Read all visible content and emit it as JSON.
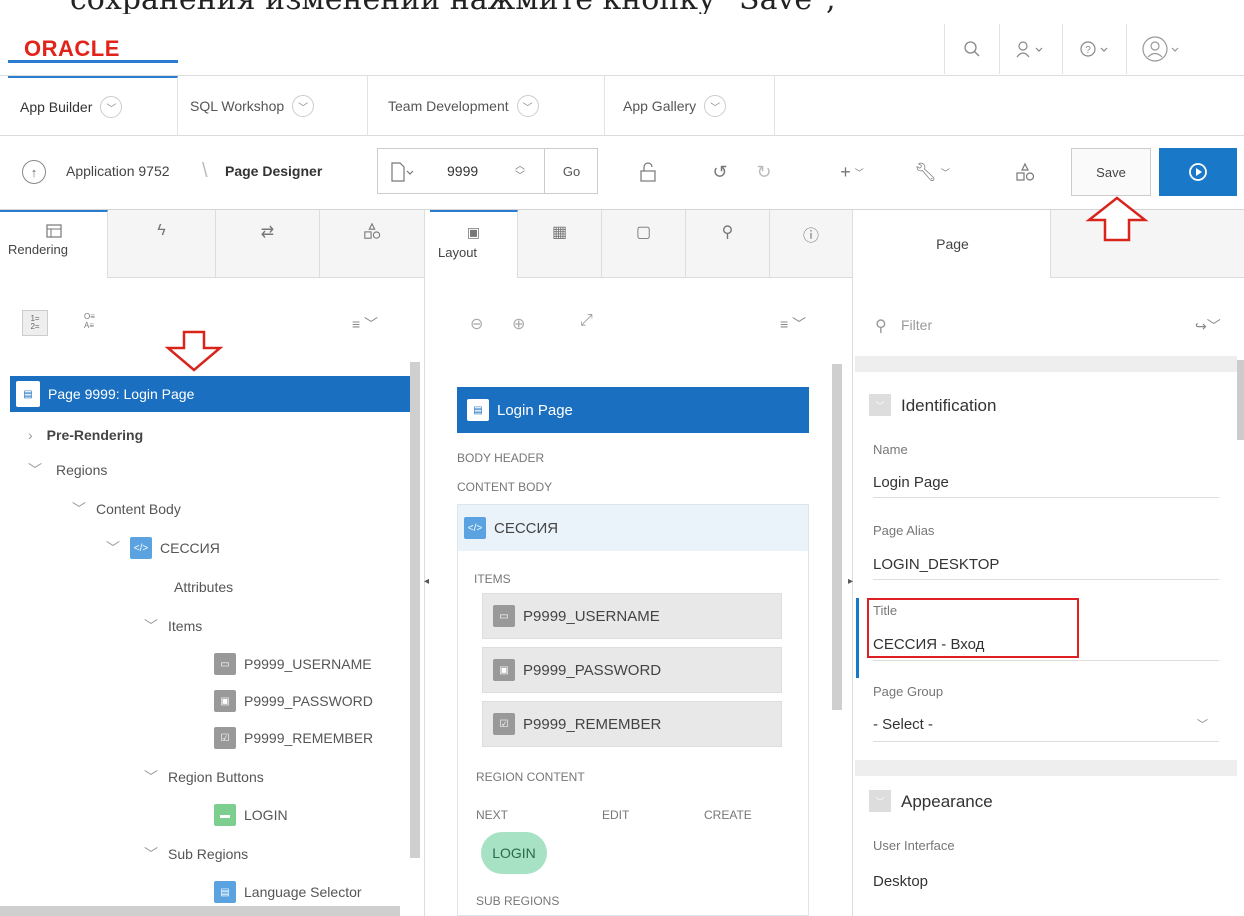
{
  "caption": "сохранения изменений нажмите кнопку \"Save\";",
  "header": {
    "logo": "ORACLE",
    "icons": [
      "search-icon",
      "user-settings-icon",
      "help-icon",
      "avatar-icon"
    ]
  },
  "tabs": [
    {
      "label": "App Builder"
    },
    {
      "label": "SQL Workshop"
    },
    {
      "label": "Team Development"
    },
    {
      "label": "App Gallery"
    }
  ],
  "toolbar": {
    "app_link": "Application 9752",
    "separator": "\\",
    "page_designer": "Page Designer",
    "page_number": "9999",
    "go": "Go",
    "save": "Save"
  },
  "left": {
    "tabs": [
      "Rendering"
    ],
    "tree": {
      "page": "Page 9999: Login Page",
      "pre_rendering": "Pre-Rendering",
      "regions": "Regions",
      "content_body": "Content Body",
      "session": "СЕССИЯ",
      "attributes": "Attributes",
      "items": "Items",
      "item_list": [
        "P9999_USERNAME",
        "P9999_PASSWORD",
        "P9999_REMEMBER"
      ],
      "region_buttons": "Region Buttons",
      "login": "LOGIN",
      "sub_regions": "Sub Regions",
      "language_selector": "Language Selector"
    }
  },
  "middle": {
    "tab": "Layout",
    "page_title": "Login Page",
    "body_header": "BODY HEADER",
    "content_body": "CONTENT BODY",
    "region": "СЕССИЯ",
    "items_label": "ITEMS",
    "items": [
      "P9999_USERNAME",
      "P9999_PASSWORD",
      "P9999_REMEMBER"
    ],
    "region_content": "REGION CONTENT",
    "next": "NEXT",
    "edit": "EDIT",
    "create": "CREATE",
    "login_btn": "LOGIN",
    "sub_regions": "SUB REGIONS"
  },
  "right": {
    "tab": "Page",
    "filter_placeholder": "Filter",
    "identification": "Identification",
    "name_label": "Name",
    "name_value": "Login Page",
    "alias_label": "Page Alias",
    "alias_value": "LOGIN_DESKTOP",
    "title_label": "Title",
    "title_value": "СЕССИЯ - Вход",
    "group_label": "Page Group",
    "group_value": "- Select -",
    "appearance": "Appearance",
    "ui_label": "User Interface",
    "ui_value": "Desktop"
  },
  "colors": {
    "accent": "#1a6fc0",
    "oracle_red": "#e2231a",
    "highlight_box": "#e02020",
    "annotation_arrow": "#d9241c",
    "login_chip": "#a8e2c4"
  }
}
